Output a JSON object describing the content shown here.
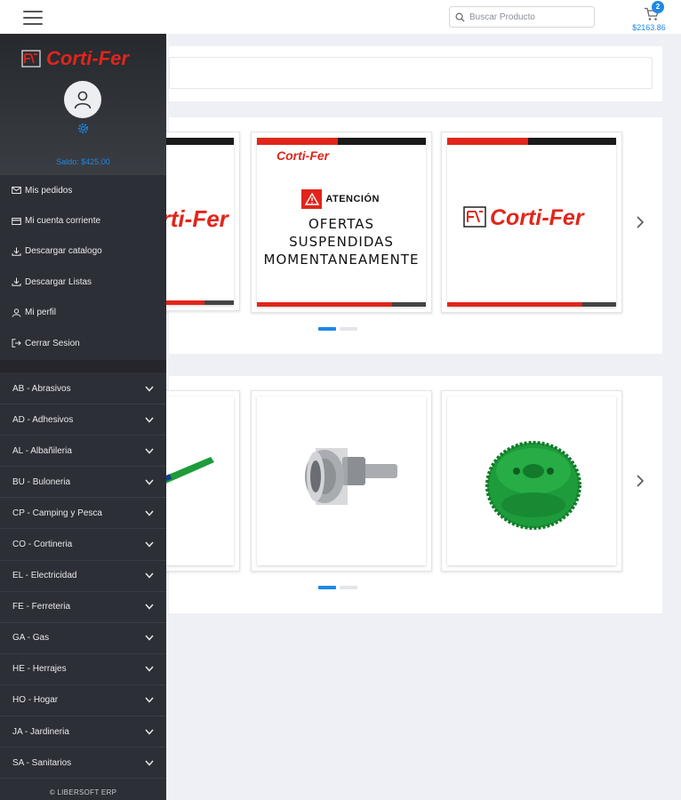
{
  "header": {
    "search_placeholder": "Buscar Producto",
    "cart_count": "2",
    "cart_total": "$2163.86"
  },
  "sidebar": {
    "brand": "Corti-Fer",
    "balance": "Saldo: $425.00",
    "menu": [
      {
        "label": "Mis pedidos",
        "icon": "mail-icon"
      },
      {
        "label": "Mi cuenta corriente",
        "icon": "card-icon"
      },
      {
        "label": "Descargar catalogo",
        "icon": "download-icon"
      },
      {
        "label": "Descargar Listas",
        "icon": "download-icon"
      },
      {
        "label": "Mi perfil",
        "icon": "user-icon"
      },
      {
        "label": "Cerrar Sesion",
        "icon": "logout-icon"
      }
    ],
    "categories": [
      "AB - Abrasivos",
      "AD - Adhesivos",
      "AL - Albañileria",
      "BU - Buloneria",
      "CP - Camping y Pesca",
      "CO - Cortineria",
      "EL - Electricidad",
      "FE - Ferreteria",
      "GA - Gas",
      "HE - Herrajes",
      "HO - Hogar",
      "JA - Jardineria",
      "SA - Sanitarios"
    ],
    "footer": "© LIBERSOFT ERP"
  },
  "banners": {
    "brand": "Corti-Fer",
    "attention": "ATENCIÓN",
    "offer_lines": [
      "OFERTAS",
      "SUSPENDIDAS",
      "MOMENTANEAMENTE"
    ]
  },
  "colors": {
    "accent": "#1e88e5",
    "brand_red": "#e1251b",
    "sidebar_bg": "#2c2f35",
    "product_green": "#1e9b3a"
  }
}
